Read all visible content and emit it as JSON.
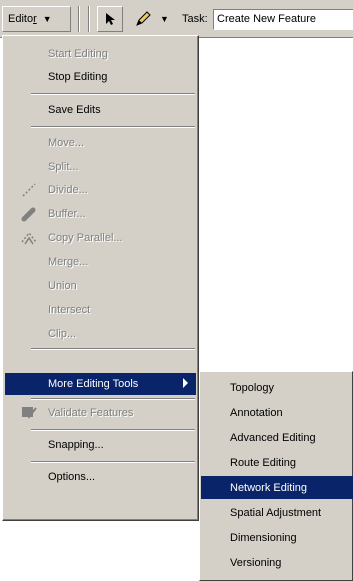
{
  "toolbar": {
    "editor_label": "Editor",
    "task_label": "Task:",
    "task_value": "Create New Feature"
  },
  "menu": {
    "start_editing": "Start Editing",
    "stop_editing": "Stop Editing",
    "save_edits": "Save Edits",
    "move": "Move...",
    "split": "Split...",
    "divide": "Divide...",
    "buffer": "Buffer...",
    "copy_parallel": "Copy Parallel...",
    "merge": "Merge...",
    "union": "Union",
    "intersect": "Intersect",
    "clip": "Clip...",
    "more_editing_tools": "More Editing Tools",
    "validate_features": "Validate Features",
    "snapping": "Snapping...",
    "options": "Options..."
  },
  "submenu": {
    "items": [
      "Topology",
      "Annotation",
      "Advanced Editing",
      "Route Editing",
      "Network Editing",
      "Spatial Adjustment",
      "Dimensioning",
      "Versioning"
    ]
  },
  "colors": {
    "highlight": "#0a246a",
    "face": "#d4d0c8"
  }
}
